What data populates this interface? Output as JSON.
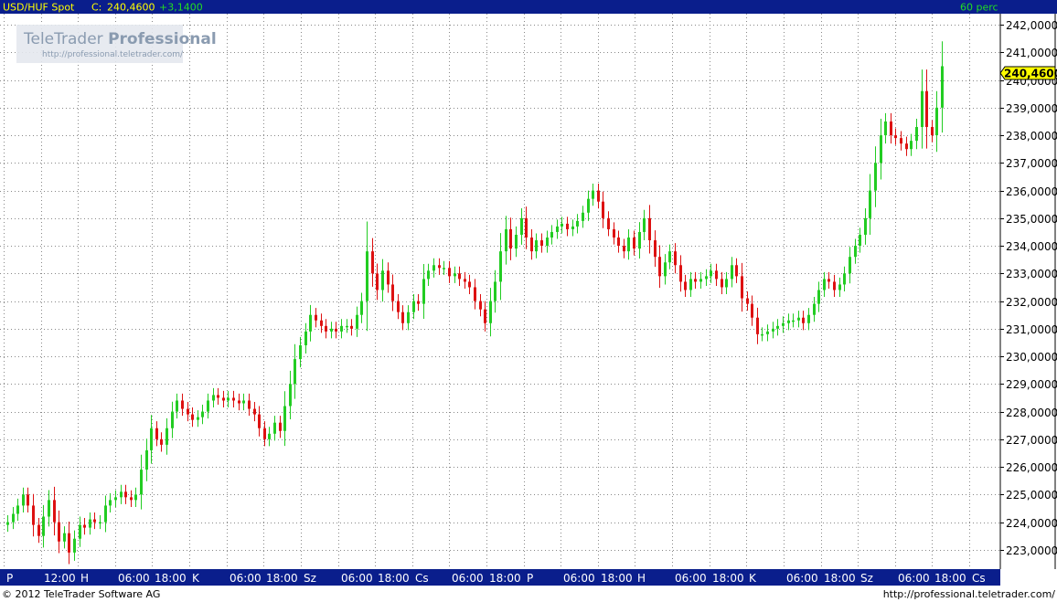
{
  "header": {
    "symbol": "USD/HUF Spot",
    "close_label": "C:",
    "close_value": "240,4600",
    "change": "+3,1400",
    "interval": "60 perc"
  },
  "watermark": {
    "brand": "TeleTrader",
    "brand_bold": "Professional",
    "url": "http://professional.teletrader.com/"
  },
  "footer": {
    "copyright": "© 2012 TeleTrader Software AG",
    "url": "http://professional.teletrader.com/"
  },
  "colors": {
    "up": "#22cc22",
    "down": "#dd1111",
    "header_bg": "#0a1e8c",
    "price_marker": "#ffff00",
    "grid": "#888888"
  },
  "chart_data": {
    "type": "candlestick",
    "title": "USD/HUF Spot",
    "last_price_label": "240,4600",
    "ylim": [
      222.3,
      242.4
    ],
    "yticks": [
      223,
      224,
      225,
      226,
      227,
      228,
      229,
      230,
      231,
      232,
      233,
      234,
      235,
      236,
      237,
      238,
      239,
      240,
      241,
      242
    ],
    "ytick_labels": [
      "223,0000",
      "224,0000",
      "225,0000",
      "226,0000",
      "227,0000",
      "228,0000",
      "229,0000",
      "230,0000",
      "231,0000",
      "232,0000",
      "233,0000",
      "234,0000",
      "235,0000",
      "236,0000",
      "237,0000",
      "238,0000",
      "239,0000",
      "240,0000",
      "241,0000",
      "242,0000"
    ],
    "xticks": [
      "P",
      "12:00",
      "H",
      "06:00",
      "18:00",
      "K",
      "06:00",
      "18:00",
      "Sz",
      "06:00",
      "18:00",
      "Cs",
      "06:00",
      "18:00",
      "P",
      "06:00",
      "18:00",
      "H",
      "06:00",
      "18:00",
      "K",
      "06:00",
      "18:00",
      "Sz",
      "06:00",
      "18:00",
      "Cs"
    ],
    "grid": true,
    "close": [
      224.0,
      224.3,
      224.6,
      225.0,
      224.6,
      223.9,
      223.5,
      224.2,
      224.8,
      224.0,
      223.3,
      223.6,
      222.9,
      223.4,
      223.9,
      223.8,
      224.1,
      224.0,
      224.0,
      224.6,
      224.8,
      224.9,
      225.1,
      224.9,
      224.8,
      225.0,
      225.9,
      226.6,
      227.4,
      227.0,
      226.8,
      227.4,
      228.0,
      228.4,
      228.1,
      227.9,
      227.7,
      227.8,
      228.0,
      228.4,
      228.6,
      228.5,
      228.4,
      228.5,
      228.4,
      228.3,
      228.4,
      228.1,
      227.9,
      227.4,
      227.0,
      227.2,
      227.6,
      227.3,
      228.2,
      229.0,
      229.9,
      230.4,
      230.9,
      231.5,
      231.3,
      231.1,
      230.9,
      231.0,
      230.9,
      231.1,
      231.1,
      231.0,
      231.5,
      232.0,
      233.8,
      233.0,
      232.4,
      233.1,
      232.6,
      232.0,
      231.6,
      231.2,
      231.6,
      232.0,
      231.9,
      232.8,
      233.1,
      233.3,
      233.2,
      233.2,
      232.9,
      233.0,
      232.8,
      232.7,
      232.5,
      232.0,
      231.7,
      231.2,
      232.0,
      232.7,
      233.8,
      234.6,
      233.9,
      234.4,
      235.0,
      234.3,
      233.8,
      234.2,
      234.0,
      234.3,
      234.5,
      234.7,
      234.8,
      234.6,
      234.7,
      234.9,
      235.2,
      235.7,
      236.0,
      235.6,
      235.0,
      234.6,
      234.3,
      234.0,
      233.8,
      234.3,
      233.9,
      234.5,
      235.0,
      234.2,
      233.6,
      232.9,
      233.4,
      233.8,
      233.3,
      232.7,
      232.4,
      232.8,
      232.7,
      232.8,
      232.9,
      233.1,
      232.8,
      232.5,
      232.8,
      233.3,
      232.9,
      232.1,
      231.9,
      231.4,
      230.8,
      230.8,
      230.9,
      231.0,
      231.1,
      231.2,
      231.3,
      231.3,
      231.4,
      231.2,
      231.5,
      231.9,
      232.4,
      232.8,
      232.7,
      232.4,
      232.6,
      233.0,
      233.6,
      234.0,
      234.4,
      235.0,
      236.0,
      237.0,
      238.0,
      238.5,
      238.0,
      237.9,
      237.7,
      237.5,
      237.8,
      238.3,
      239.6,
      238.3,
      238.0,
      239.0,
      240.5
    ],
    "open": [
      223.9,
      224.0,
      224.3,
      224.6,
      225.0,
      224.6,
      223.9,
      223.5,
      224.2,
      224.8,
      224.0,
      223.3,
      223.6,
      222.9,
      223.4,
      223.9,
      223.8,
      224.1,
      224.0,
      224.0,
      224.6,
      224.8,
      224.9,
      225.1,
      224.9,
      224.8,
      225.0,
      225.9,
      226.6,
      227.4,
      227.0,
      226.8,
      227.4,
      228.0,
      228.4,
      228.1,
      227.9,
      227.7,
      227.8,
      228.0,
      228.4,
      228.6,
      228.5,
      228.4,
      228.5,
      228.4,
      228.3,
      228.4,
      228.1,
      227.9,
      227.4,
      227.0,
      227.2,
      227.6,
      227.3,
      228.2,
      229.0,
      229.9,
      230.4,
      230.9,
      231.5,
      231.3,
      231.1,
      230.9,
      231.0,
      230.9,
      231.1,
      231.1,
      231.0,
      231.5,
      232.0,
      233.8,
      233.0,
      232.4,
      233.1,
      232.6,
      232.0,
      231.6,
      231.2,
      231.6,
      232.0,
      231.9,
      232.8,
      233.1,
      233.3,
      233.2,
      233.2,
      232.9,
      233.0,
      232.8,
      232.7,
      232.5,
      232.0,
      231.7,
      231.2,
      232.0,
      232.7,
      233.8,
      234.6,
      233.9,
      234.4,
      235.0,
      234.3,
      233.8,
      234.2,
      234.0,
      234.3,
      234.5,
      234.7,
      234.8,
      234.6,
      234.7,
      234.9,
      235.2,
      235.7,
      236.0,
      235.6,
      235.0,
      234.6,
      234.3,
      234.0,
      233.8,
      234.3,
      233.9,
      234.5,
      235.0,
      234.2,
      233.6,
      232.9,
      233.4,
      233.8,
      233.3,
      232.7,
      232.4,
      232.8,
      232.7,
      232.8,
      232.9,
      233.1,
      232.8,
      232.5,
      232.8,
      233.3,
      232.9,
      232.1,
      231.9,
      231.4,
      230.8,
      230.8,
      230.9,
      231.0,
      231.1,
      231.2,
      231.3,
      231.3,
      231.4,
      231.2,
      231.5,
      231.9,
      232.4,
      232.8,
      232.7,
      232.4,
      232.6,
      233.0,
      233.6,
      234.0,
      234.4,
      235.0,
      236.0,
      237.0,
      238.0,
      238.5,
      238.0,
      237.9,
      237.7,
      237.5,
      237.8,
      238.3,
      239.6,
      238.3,
      238.0,
      239.0
    ]
  }
}
